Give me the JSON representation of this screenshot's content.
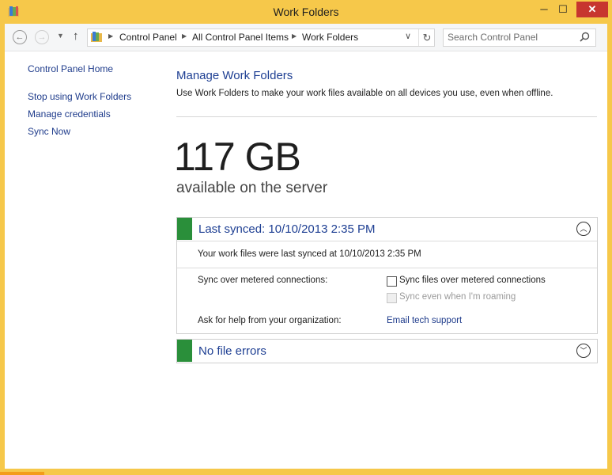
{
  "window": {
    "title": "Work Folders",
    "controls": {
      "minimize": "─",
      "maximize": "☐",
      "close": "✕"
    }
  },
  "navigation": {
    "back_icon": "←",
    "forward_icon": "→",
    "recent_icon": "▼",
    "up_icon": "↑",
    "separator": "▶",
    "breadcrumbs": [
      "Control Panel",
      "All Control Panel Items",
      "Work Folders"
    ],
    "dropdown_icon": "∨",
    "refresh_icon": "↻",
    "search_placeholder": "Search Control Panel",
    "search_icon": "search-icon"
  },
  "sidebar": {
    "items": [
      {
        "label": "Control Panel Home"
      },
      {
        "label": "Stop using Work Folders"
      },
      {
        "label": "Manage credentials"
      },
      {
        "label": "Sync Now"
      }
    ]
  },
  "main": {
    "title": "Manage Work Folders",
    "description": "Use Work Folders to make your work files available on all devices you use, even when offline.",
    "storage": {
      "amount": "117 GB",
      "caption": "available on the server"
    }
  },
  "sync_panel": {
    "title": "Last synced: 10/10/2013 2:35 PM",
    "toggle_icon": "︿",
    "status_color": "#2a8f3a",
    "last_synced_text": "Your work files were last synced at 10/10/2013 2:35 PM",
    "metered_label": "Sync over metered connections:",
    "metered_option": "Sync files over metered connections",
    "roaming_option": "Sync even when I'm roaming",
    "help_label": "Ask for help from your organization:",
    "help_link": "Email tech support"
  },
  "errors_panel": {
    "title": "No file errors",
    "toggle_icon": "﹀",
    "status_color": "#2a8f3a"
  },
  "colors": {
    "window_frame": "#f6c84a",
    "link": "#1e3b8b",
    "heading": "#1e3f93",
    "status_ok": "#2a8f3a",
    "close_button": "#c7352f"
  }
}
